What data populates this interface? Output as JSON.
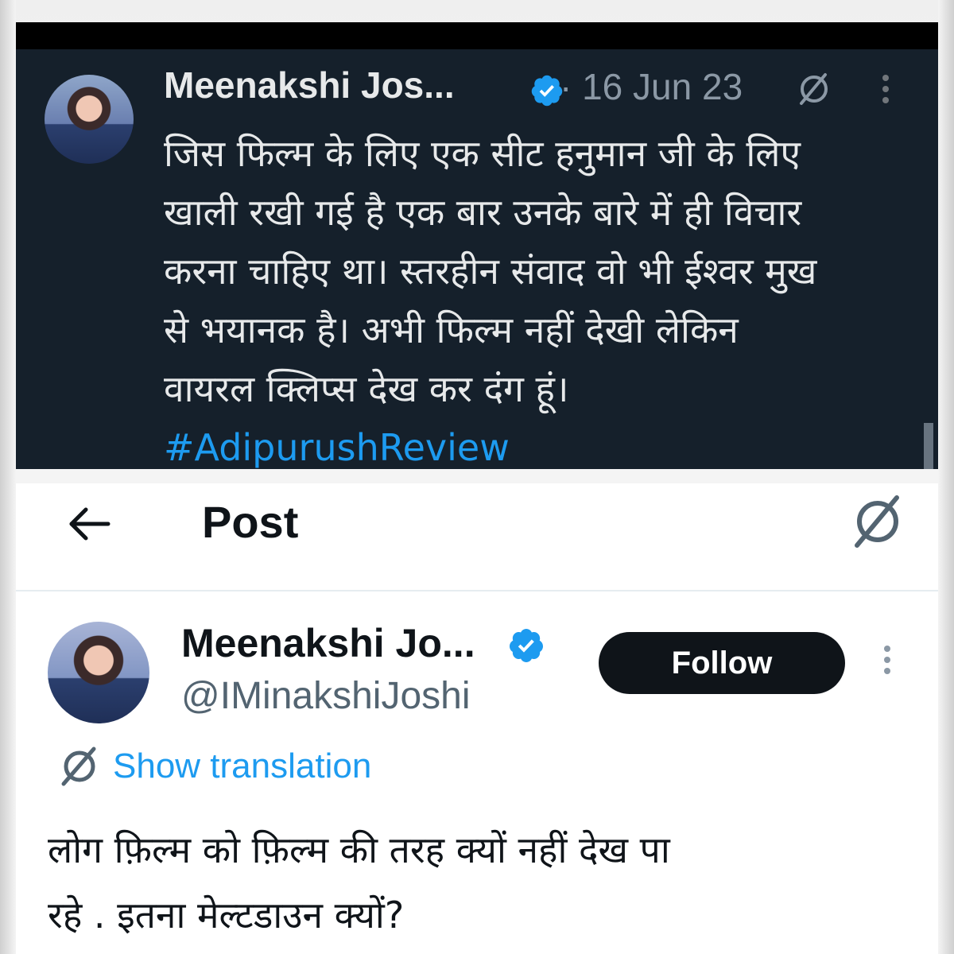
{
  "top_tweet": {
    "author_name": "Meenakshi Jos...",
    "date": "· 16 Jun 23",
    "lines": [
      "जिस फिल्म के लिए एक सीट हनुमान जी के लिए",
      "खाली रखी गई है एक बार उनके बारे में ही विचार",
      "करना चाहिए था। स्तरहीन संवाद वो भी ईश्वर मुख",
      "से भयानक है। अभी फिल्म नहीं देखी लेकिन",
      "वायरल क्लिप्स देख कर दंग हूं।"
    ],
    "hashtag": "#AdipurushReview"
  },
  "post_view": {
    "header_title": "Post",
    "author_name": "Meenakshi Jo...",
    "handle": "@IMinakshiJoshi",
    "follow_label": "Follow",
    "translation_label": "Show translation",
    "lines": [
      "लोग फ़िल्म को फ़िल्म की तरह क्यों नहीं देख पा",
      "रहे . इतना मेल्टडाउन क्यों?"
    ]
  },
  "icons": {
    "verified": "verified-badge-icon",
    "grok": "grok-icon",
    "more": "more-vertical-icon",
    "back": "back-arrow-icon"
  },
  "colors": {
    "dark_bg": "#15202b",
    "accent": "#1d9bf0",
    "follow_bg": "#0f1419"
  }
}
